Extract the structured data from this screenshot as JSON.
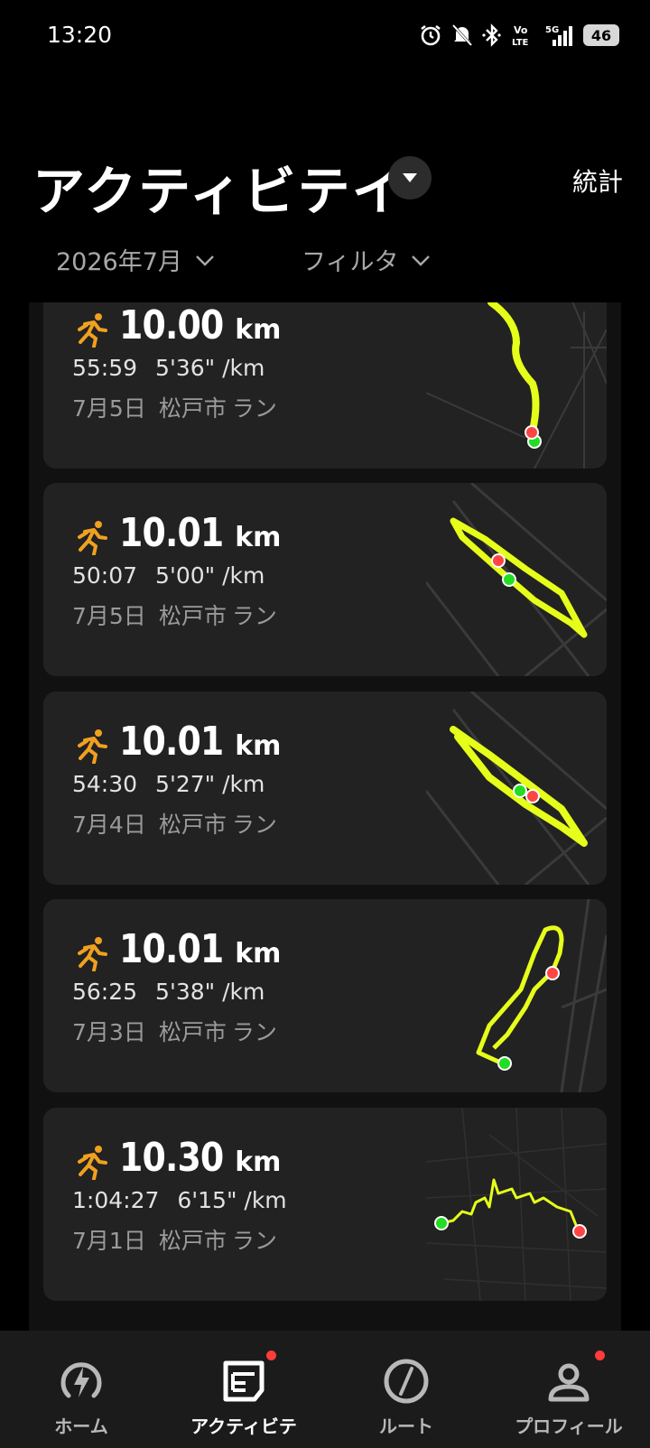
{
  "status_bar": {
    "time": "13:20",
    "battery": "46",
    "icons": [
      "alarm-icon",
      "bell-off-icon",
      "bluetooth-icon",
      "volte-icon",
      "5g-signal-icon",
      "battery-icon"
    ]
  },
  "header": {
    "title": "アクティビテイ",
    "dropdown_icon": "caret-down-icon",
    "stats_link": "統計"
  },
  "filters": {
    "month": "2026年7月",
    "filter": "フィルタ"
  },
  "colors": {
    "accent_runner": "#f0a020",
    "route_line": "#e6ff1a",
    "start_point": "#22dd22",
    "end_point": "#ff4444",
    "card_bg": "#222222"
  },
  "activities": [
    {
      "distance": "10.00",
      "unit": "km",
      "duration": "55:59",
      "pace": "5'36\" /km",
      "date": "7月5日",
      "location": "松戸市",
      "type": "ラン"
    },
    {
      "distance": "10.01",
      "unit": "km",
      "duration": "50:07",
      "pace": "5'00\" /km",
      "date": "7月5日",
      "location": "松戸市",
      "type": "ラン"
    },
    {
      "distance": "10.01",
      "unit": "km",
      "duration": "54:30",
      "pace": "5'27\" /km",
      "date": "7月4日",
      "location": "松戸市",
      "type": "ラン"
    },
    {
      "distance": "10.01",
      "unit": "km",
      "duration": "56:25",
      "pace": "5'38\" /km",
      "date": "7月3日",
      "location": "松戸市",
      "type": "ラン"
    },
    {
      "distance": "10.30",
      "unit": "km",
      "duration": "1:04:27",
      "pace": "6'15\" /km",
      "date": "7月1日",
      "location": "松戸市",
      "type": "ラン"
    }
  ],
  "bottom_nav": {
    "items": [
      {
        "label": "ホーム",
        "icon": "bolt-icon"
      },
      {
        "label": "アクティビテ",
        "icon": "activity-icon"
      },
      {
        "label": "ルート",
        "icon": "compass-icon"
      },
      {
        "label": "プロフィール",
        "icon": "person-icon"
      }
    ]
  }
}
